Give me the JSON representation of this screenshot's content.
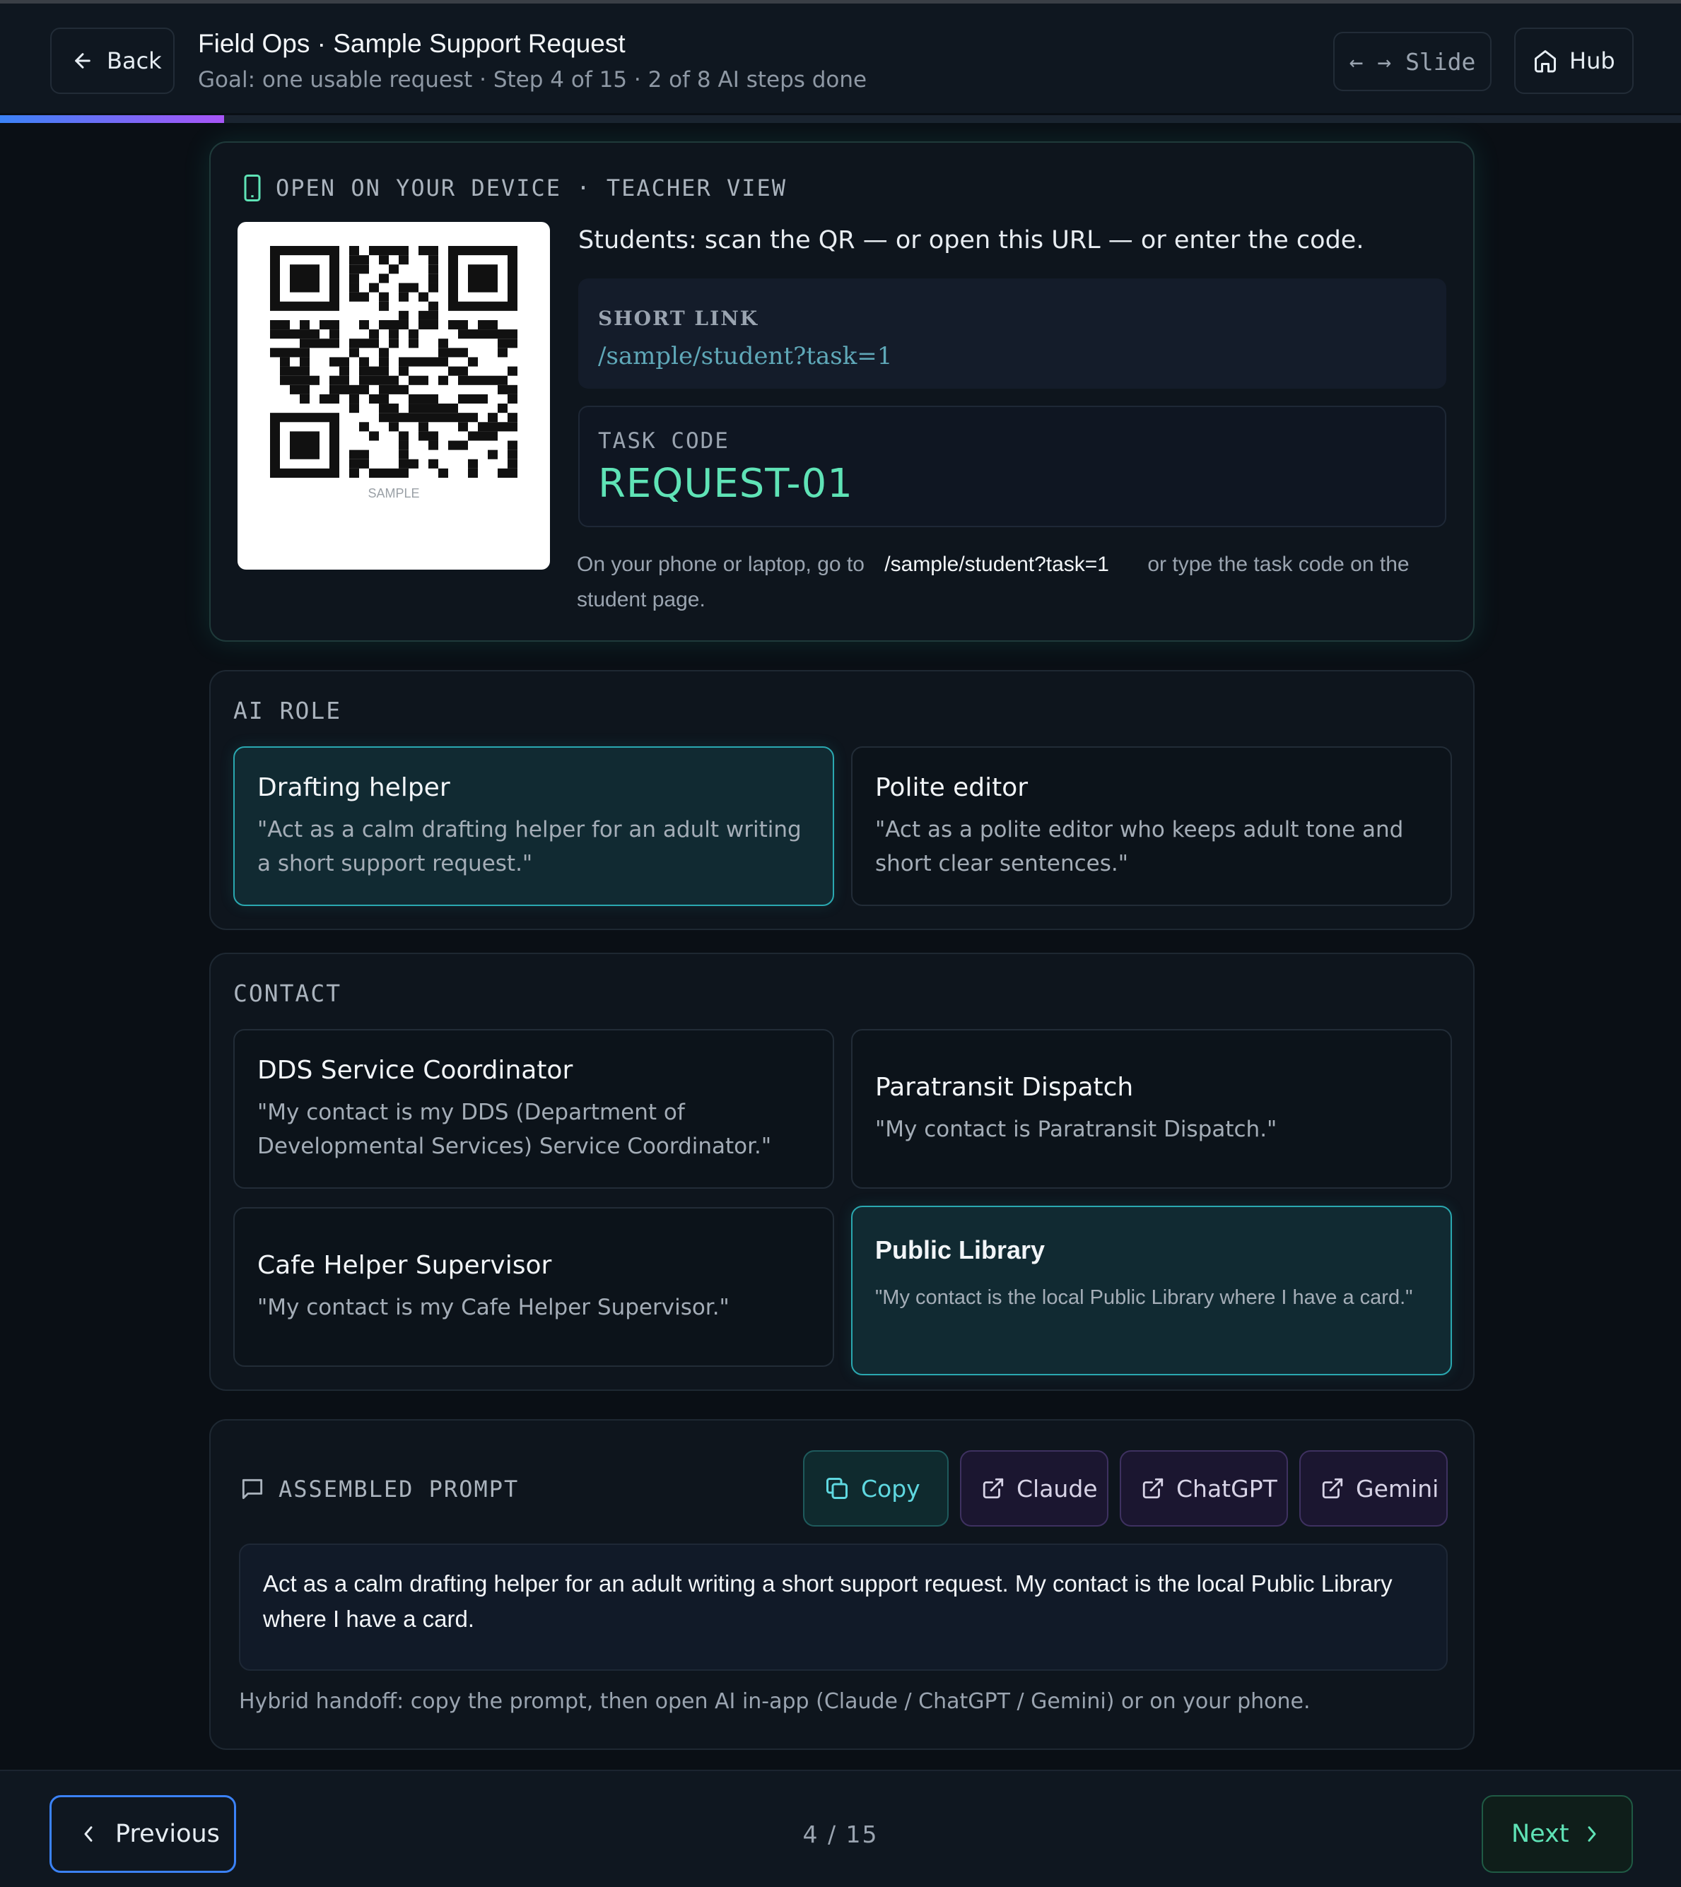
{
  "header": {
    "back_label": "Back",
    "title": "Field Ops · Sample Support Request",
    "subtitle": "Goal: one usable request · Step 4 of 15 · 2 of 8 AI steps done",
    "slide_label": "← → Slide",
    "hub_label": "Hub",
    "progress_fraction": 0.1333
  },
  "device": {
    "heading": "OPEN ON YOUR DEVICE · TEACHER VIEW",
    "qr_caption": "SAMPLE",
    "instructions": "Students: scan the QR — or open this URL — or enter the code.",
    "short_link_label": "SHORT LINK",
    "short_link_url": "/sample/student?task=1",
    "task_code_label": "TASK CODE",
    "task_code_value": "REQUEST-01",
    "howto_prefix": "On your phone or laptop, go to",
    "howto_url": "/sample/student?task=1",
    "howto_suffix": "or type the task code on the student page."
  },
  "ai_role": {
    "label": "AI ROLE",
    "options": [
      {
        "title": "Drafting helper",
        "desc": "\"Act as a calm drafting helper for an adult writing a short support request.\"",
        "selected": true
      },
      {
        "title": "Polite editor",
        "desc": "\"Act as a polite editor who keeps adult tone and short clear sentences.\"",
        "selected": false
      }
    ]
  },
  "contact": {
    "label": "CONTACT",
    "options": [
      {
        "title": "DDS Service Coordinator",
        "desc": "\"My contact is my DDS (Department of Developmental Services) Service Coordinator.\"",
        "selected": false
      },
      {
        "title": "Paratransit Dispatch",
        "desc": "\"My contact is Paratransit Dispatch.\"",
        "selected": false
      },
      {
        "title": "Cafe Helper Supervisor",
        "desc": "\"My contact is my Cafe Helper Supervisor.\"",
        "selected": false
      },
      {
        "title": "Public Library",
        "desc": "\"My contact is the local Public Library where I have a card.\"",
        "selected": true
      }
    ]
  },
  "prompt": {
    "label": "ASSEMBLED PROMPT",
    "copy_label": "Copy",
    "claude_label": "Claude",
    "chatgpt_label": "ChatGPT",
    "gemini_label": "Gemini",
    "text": "Act as a calm drafting helper for an adult writing a short support request. My contact is the local Public Library where I have a card.",
    "handoff_note": "Hybrid handoff: copy the prompt, then open AI in-app (Claude / ChatGPT / Gemini) or on your phone."
  },
  "footer": {
    "previous_label": "Previous",
    "page_indicator": "4 / 15",
    "next_label": "Next"
  },
  "colors": {
    "background": "#0a0f15",
    "accent_teal": "#5fe3b6",
    "accent_cyan": "#2aa8b0",
    "accent_blue": "#3b82f6",
    "accent_purple": "#a855f7"
  },
  "icons": {
    "back": "arrow-left-icon",
    "hub": "home-icon",
    "device": "phone-icon",
    "prompt": "message-square-icon",
    "copy": "copy-icon",
    "external": "external-link-icon",
    "prev": "chevron-left-icon",
    "next": "chevron-right-icon"
  }
}
